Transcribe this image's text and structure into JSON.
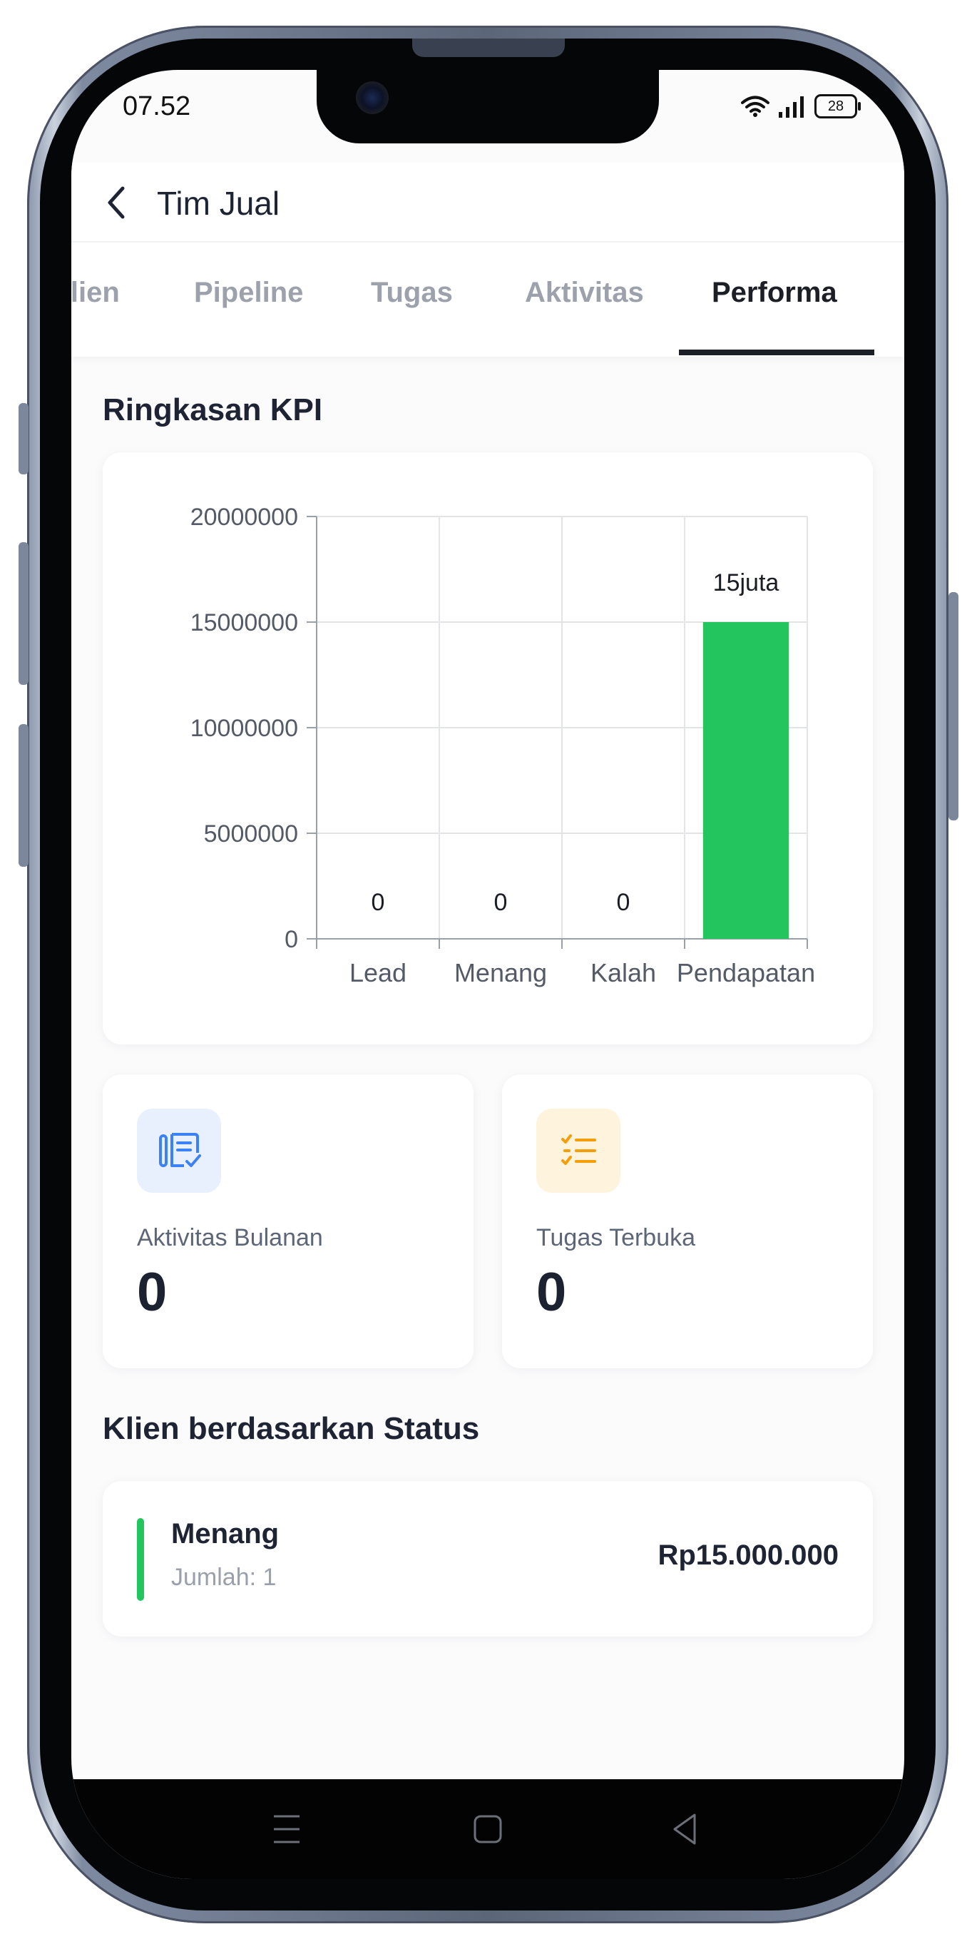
{
  "status_bar": {
    "time": "07.52",
    "battery": "28"
  },
  "header": {
    "title": "Tim Jual"
  },
  "tabs": [
    {
      "label": "Klien",
      "active": false
    },
    {
      "label": "Pipeline",
      "active": false
    },
    {
      "label": "Tugas",
      "active": false
    },
    {
      "label": "Aktivitas",
      "active": false
    },
    {
      "label": "Performa",
      "active": true
    }
  ],
  "kpi_section": {
    "title": "Ringkasan KPI"
  },
  "chart_data": {
    "type": "bar",
    "categories": [
      "Lead",
      "Menang",
      "Kalah",
      "Pendapatan"
    ],
    "values": [
      0,
      0,
      0,
      15000000
    ],
    "data_labels": [
      "0",
      "0",
      "0",
      "15juta"
    ],
    "y_ticks": [
      "0",
      "5000000",
      "10000000",
      "15000000",
      "20000000"
    ],
    "ylim": [
      0,
      20000000
    ],
    "grid": true,
    "bar_color": "#22c55e"
  },
  "kpi_cards": [
    {
      "label": "Aktivitas Bulanan",
      "value": "0",
      "icon": "notes-check-icon",
      "icon_color": "#3b82f6",
      "icon_bg": "#e8f0fe"
    },
    {
      "label": "Tugas Terbuka",
      "value": "0",
      "icon": "checklist-icon",
      "icon_color": "#f59e0b",
      "icon_bg": "#fef3dc"
    }
  ],
  "status_section": {
    "title": "Klien berdasarkan Status",
    "items": [
      {
        "name": "Menang",
        "count": "Jumlah: 1",
        "amount": "Rp15.000.000",
        "color": "#22c55e"
      }
    ]
  }
}
